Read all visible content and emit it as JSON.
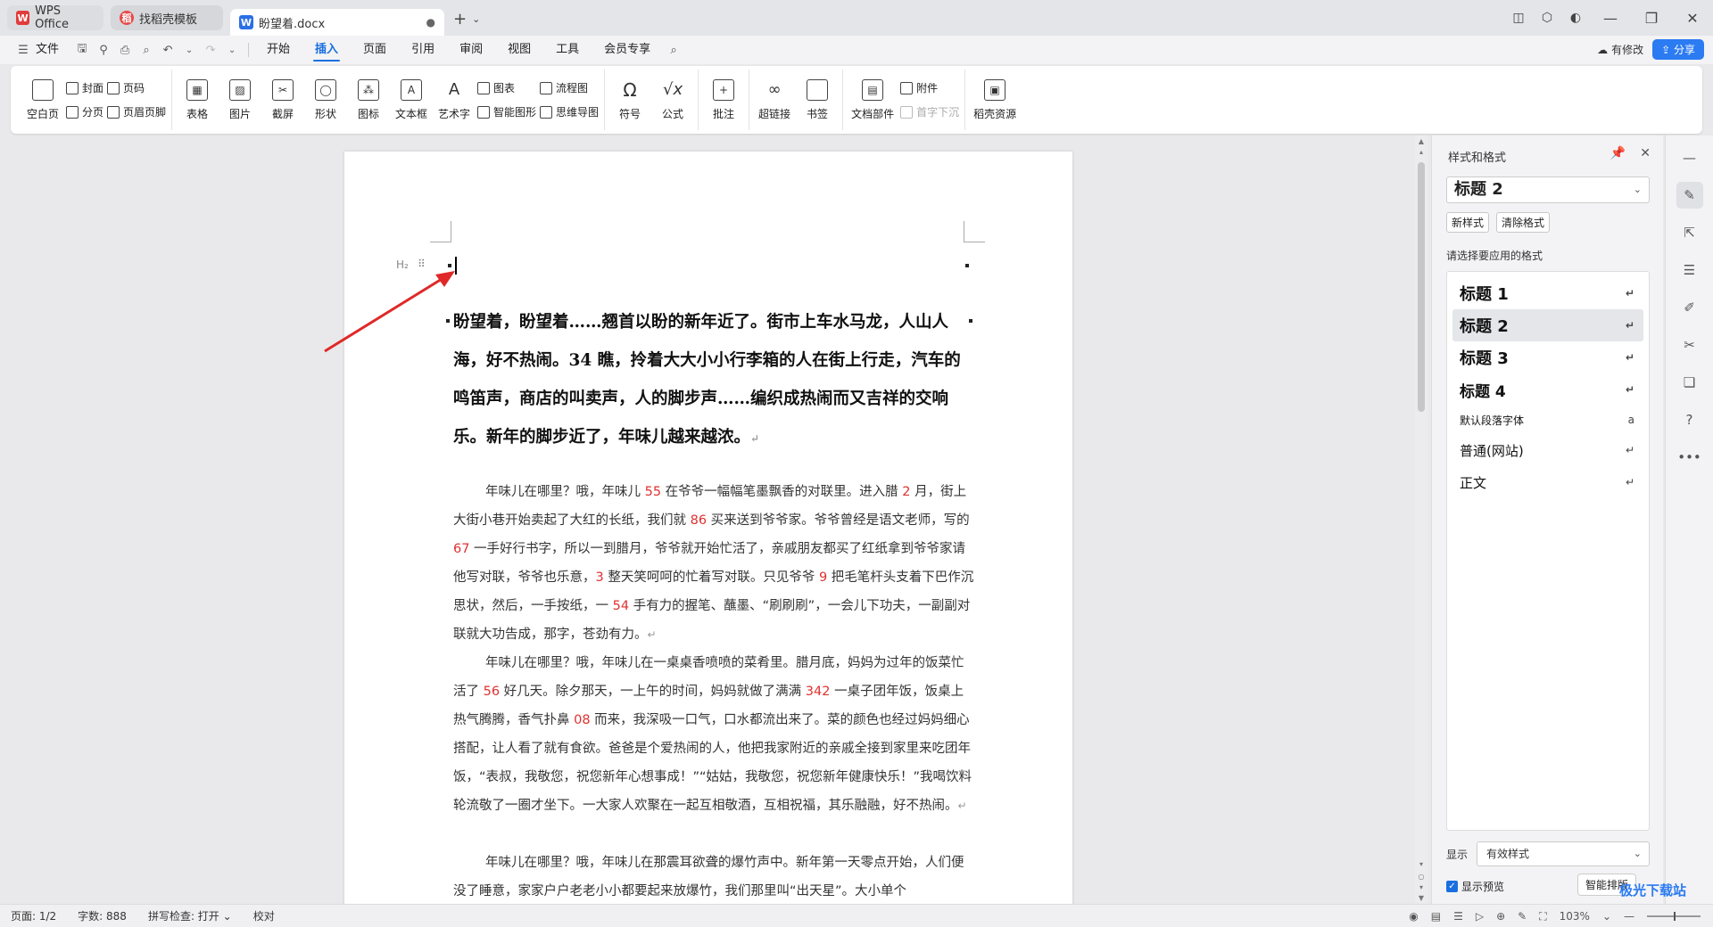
{
  "tabs": {
    "wps": "WPS Office",
    "template": "找稻壳模板",
    "document": "盼望着.docx"
  },
  "menu": {
    "file": "文件",
    "items": [
      "开始",
      "插入",
      "页面",
      "引用",
      "审阅",
      "视图",
      "工具",
      "会员专享"
    ],
    "active": "插入",
    "modified": "有修改",
    "share": "分享"
  },
  "ribbon": {
    "blank_page": "空白页",
    "cover": "封面",
    "page_break": "分页",
    "page_number": "页码",
    "header_footer": "页眉页脚",
    "table": "表格",
    "picture": "图片",
    "screenshot": "截屏",
    "shape": "形状",
    "icon": "图标",
    "textbox": "文本框",
    "wordart": "艺术字",
    "chart": "图表",
    "smart_graphic": "智能图形",
    "flowchart": "流程图",
    "mindmap": "思维导图",
    "symbol": "符号",
    "formula": "公式",
    "comment": "批注",
    "hyperlink": "超链接",
    "bookmark": "书签",
    "doc_parts": "文档部件",
    "attachment": "附件",
    "drop_cap": "首字下沉",
    "daoke": "稻壳资源"
  },
  "document": {
    "heading_marker": "H₂",
    "heading_paragraph": "盼望着，盼望着……翘首以盼的新年近了。街市上车水马龙，人山人海，好不热闹。34 瞧，拎着大大小小行李箱的人在街上行走，汽车的鸣笛声，商店的叫卖声，人的脚步声……编织成热闹而又吉祥的交响乐。新年的脚步近了，年味儿越来越浓。",
    "para1": [
      {
        "t": "年味儿在哪里？哦，年味儿 "
      },
      {
        "t": "55",
        "red": true
      },
      {
        "t": " 在爷爷一幅幅笔墨飘香的对联里。进入腊 "
      },
      {
        "t": "2",
        "red": true
      },
      {
        "t": " 月，街上大街小巷开始卖起了大红的长纸，我们就 "
      },
      {
        "t": "86",
        "red": true
      },
      {
        "t": " 买来送到爷爷家。爷爷曾经是语文老师，写的 "
      },
      {
        "t": "67",
        "red": true
      },
      {
        "t": " 一手好行书字，所以一到腊月，爷爷就开始忙活了，亲戚朋友都买了红纸拿到爷爷家请他写对联，爷爷也乐意，"
      },
      {
        "t": "3",
        "red": true
      },
      {
        "t": " 整天笑呵呵的忙着写对联。只见爷爷 "
      },
      {
        "t": "9",
        "red": true
      },
      {
        "t": " 把毛笔杆头支着下巴作沉思状，然后，一手按纸，一 "
      },
      {
        "t": "54",
        "red": true
      },
      {
        "t": " 手有力的握笔、蘸墨、“刷刷刷”，一会儿下功夫，一副副对联就大功告成，那字，苍劲有力。"
      }
    ],
    "para2": [
      {
        "t": "年味儿在哪里？哦，年味儿在一桌桌香喷喷的菜肴里。腊月底，妈妈为过年的饭菜忙活了 "
      },
      {
        "t": "56",
        "red": true
      },
      {
        "t": " 好几天。除夕那天，一上午的时间，妈妈就做了满满 "
      },
      {
        "t": "342",
        "red": true
      },
      {
        "t": " 一桌子团年饭，饭桌上热气腾腾，香气扑鼻 "
      },
      {
        "t": "08",
        "red": true
      },
      {
        "t": " 而来，我深吸一口气，口水都流出来了。菜的颜色也经过妈妈细心搭配，让人看了就有食欲。爸爸是个爱热闹的人，他把我家附近的亲戚全接到家里来吃团年饭，“表叔，我敬您，祝您新年心想事成！”“姑姑，我敬您，祝您新年健康快乐！”我喝饮料轮流敬了一圈才坐下。一大家人欢聚在一起互相敬酒，互相祝福，其乐融融，好不热闹。"
      }
    ],
    "para3": [
      {
        "t": "年味儿在哪里？哦，年味儿在那震耳欲聋的爆竹声中。新年第一天零点开始，人们便没了睡意，家家户户老老小小都要起来放爆竹，我们那里叫“出天星”。大小单个"
      }
    ],
    "para_mark": "↵"
  },
  "style_panel": {
    "title": "样式和格式",
    "current": "标题 2",
    "new_style": "新样式",
    "clear_format": "清除格式",
    "hint": "请选择要应用的格式",
    "styles": [
      "标题 1",
      "标题 2",
      "标题 3",
      "标题 4",
      "默认段落字体",
      "普通(网站)",
      "正文"
    ],
    "selected": "标题 2",
    "show_label": "显示",
    "show_value": "有效样式",
    "show_preview": "显示预览",
    "smart_layout": "智能排版"
  },
  "status": {
    "page": "页面: 1/2",
    "words": "字数: 888",
    "spell": "拼写检查: 打开",
    "proof": "校对",
    "zoom": "103%"
  },
  "watermark": "极光下载站"
}
